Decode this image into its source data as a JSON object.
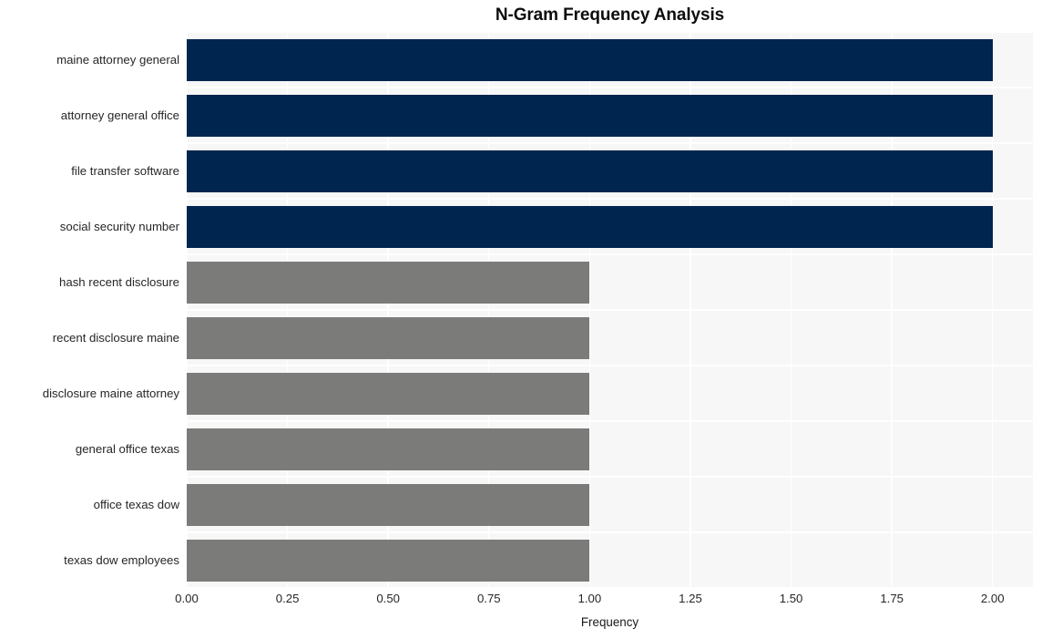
{
  "chart_data": {
    "type": "bar",
    "orientation": "horizontal",
    "title": "N-Gram Frequency Analysis",
    "xlabel": "Frequency",
    "ylabel": "",
    "xlim": [
      0,
      2.1
    ],
    "xticks": [
      "0.00",
      "0.25",
      "0.50",
      "0.75",
      "1.00",
      "1.25",
      "1.50",
      "1.75",
      "2.00"
    ],
    "xtick_values": [
      0,
      0.25,
      0.5,
      0.75,
      1.0,
      1.25,
      1.5,
      1.75,
      2.0
    ],
    "categories": [
      "maine attorney general",
      "attorney general office",
      "file transfer software",
      "social security number",
      "hash recent disclosure",
      "recent disclosure maine",
      "disclosure maine attorney",
      "general office texas",
      "office texas dow",
      "texas dow employees"
    ],
    "values": [
      2,
      2,
      2,
      2,
      1,
      1,
      1,
      1,
      1,
      1
    ],
    "bar_colors": [
      "#00254f",
      "#00254f",
      "#00254f",
      "#00254f",
      "#7b7b79",
      "#7b7b79",
      "#7b7b79",
      "#7b7b79",
      "#7b7b79",
      "#7b7b79"
    ],
    "grid": true,
    "legend": null,
    "plot_background": "#f7f7f7",
    "figure_background": "#ffffff",
    "gridline_color": "#ffffff"
  }
}
